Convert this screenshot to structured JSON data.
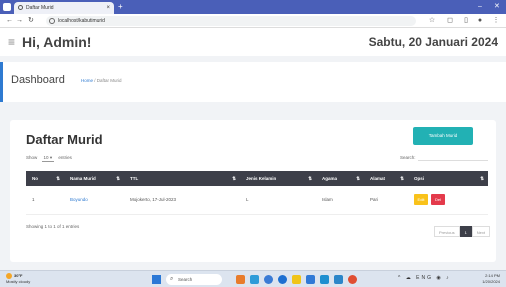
{
  "browser": {
    "tab_title": "Daftar Murid",
    "tab_close": "×",
    "new_tab": "+",
    "url": "localhost/kabutimurid",
    "window_minimize": "–",
    "window_close": "✕"
  },
  "header": {
    "greeting": "Hi, Admin!",
    "date": "Sabtu, 20 Januari 2024"
  },
  "titlebar": {
    "title": "Dashboard",
    "breadcrumb_home": "Home",
    "breadcrumb_sep": " / ",
    "breadcrumb_current": "Daftar Murid"
  },
  "card": {
    "title": "Daftar Murid",
    "add_button": "Tambah Murid",
    "show_label": "Show",
    "show_value": "10",
    "entries_label": "entries",
    "search_label": "Search:"
  },
  "table": {
    "columns": [
      "No",
      "Nama Murid",
      "TTL",
      "Jenis Kelamin",
      "Agama",
      "Alamat",
      "Opsi"
    ],
    "rows": [
      {
        "no": "1",
        "nama": "Boyundo",
        "ttl": "Mojokerto, 17-Jul-2023",
        "jk": "L",
        "agama": "Islam",
        "alamat": "Pari"
      }
    ],
    "edit_label": "Edit",
    "delete_label": "Del"
  },
  "footer": {
    "showing": "Showing 1 to 1 of 1 entries",
    "prev": "Previous",
    "page": "1",
    "next": "Next"
  },
  "taskbar": {
    "temp": "30°F",
    "weather": "Mostly cloudy",
    "search_placeholder": "Search",
    "lang": "ENG",
    "time": "2:14 PM",
    "date": "1/20/2024"
  },
  "colors": {
    "accent": "#2e7ad1",
    "add_button": "#22b1b4",
    "table_header": "#3d3f49",
    "edit": "#f9c21a",
    "delete": "#e43a4b",
    "browser_bar": "#4a5fb8"
  }
}
